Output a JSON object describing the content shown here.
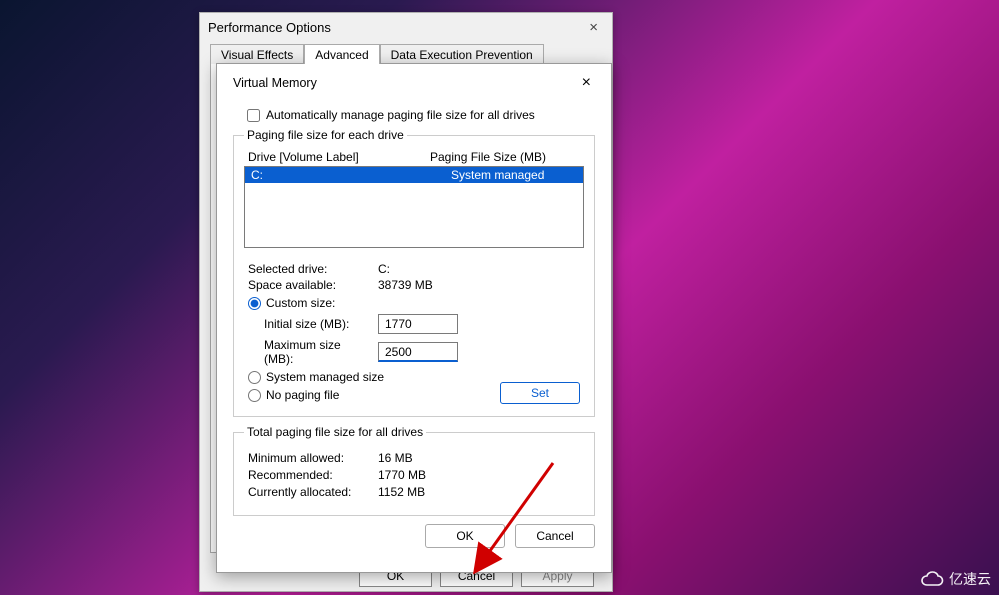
{
  "perf": {
    "title": "Performance Options",
    "tabs": [
      "Visual Effects",
      "Advanced",
      "Data Execution Prevention"
    ],
    "active_tab": 1,
    "buttons": {
      "ok": "OK",
      "cancel": "Cancel",
      "apply": "Apply"
    }
  },
  "vm": {
    "title": "Virtual Memory",
    "auto_manage_label": "Automatically manage paging file size for all drives",
    "auto_manage_checked": false,
    "group_each_drive": "Paging file size for each drive",
    "headers": {
      "col1": "Drive  [Volume Label]",
      "col2": "Paging File Size (MB)"
    },
    "drives": [
      {
        "drive": "C:",
        "size": "System managed",
        "selected": true
      }
    ],
    "selected_drive_label": "Selected drive:",
    "selected_drive_value": "C:",
    "space_available_label": "Space available:",
    "space_available_value": "38739 MB",
    "radios": {
      "custom": "Custom size:",
      "system": "System managed size",
      "none": "No paging file",
      "selected": "custom"
    },
    "initial_label": "Initial size (MB):",
    "initial_value": "1770",
    "max_label": "Maximum size (MB):",
    "max_value": "2500",
    "set_button": "Set",
    "total_group": "Total paging file size for all drives",
    "minimum_label": "Minimum allowed:",
    "minimum_value": "16 MB",
    "recommended_label": "Recommended:",
    "recommended_value": "1770 MB",
    "current_label": "Currently allocated:",
    "current_value": "1152 MB",
    "buttons": {
      "ok": "OK",
      "cancel": "Cancel"
    }
  },
  "watermark": "亿速云"
}
